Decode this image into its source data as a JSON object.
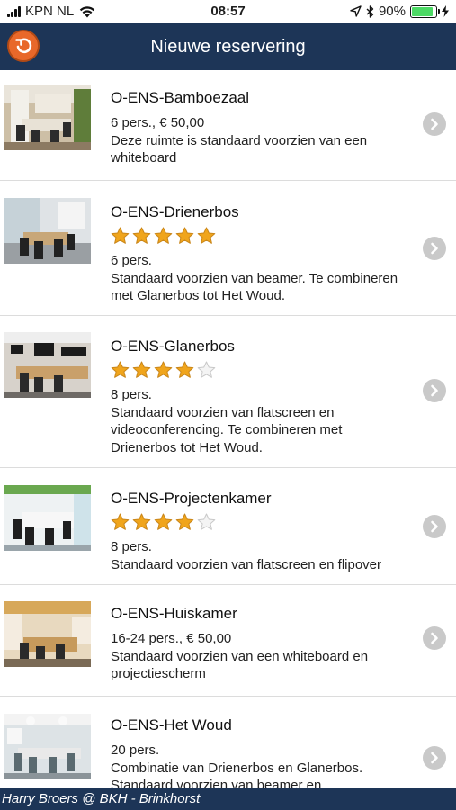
{
  "status_bar": {
    "carrier": "KPN NL",
    "time": "08:57",
    "battery_percent": "90%",
    "battery_level": 0.9
  },
  "nav": {
    "title": "Nieuwe reservering",
    "back_icon": "back-arrow-icon"
  },
  "rooms": [
    {
      "name": "O-ENS-Bamboezaal",
      "rating": null,
      "capacity_price": "6 pers., € 50,00",
      "description": "Deze ruimte is standaard voorzien van een whiteboard"
    },
    {
      "name": "O-ENS-Drienerbos",
      "rating": 5,
      "capacity_price": "6 pers.",
      "description": "Standaard voorzien van beamer. Te combineren met Glanerbos tot Het Woud."
    },
    {
      "name": "O-ENS-Glanerbos",
      "rating": 4,
      "capacity_price": "8 pers.",
      "description": "Standaard voorzien van flatscreen en videoconferencing. Te combineren met Drienerbos tot Het Woud."
    },
    {
      "name": "O-ENS-Projectenkamer",
      "rating": 4,
      "capacity_price": "8 pers.",
      "description": "Standaard voorzien van flatscreen en flipover"
    },
    {
      "name": "O-ENS-Huiskamer",
      "rating": null,
      "capacity_price": "16-24 pers., € 50,00",
      "description": "Standaard voorzien van een whiteboard en projectiescherm"
    },
    {
      "name": "O-ENS-Het Woud",
      "rating": null,
      "capacity_price": "20 pers.",
      "description": "Combinatie van Drienerbos en Glanerbos. Standaard voorzien van beamer en"
    }
  ],
  "footer": {
    "text": "Harry Broers @ BKH - Brinkhorst"
  },
  "colors": {
    "nav_bg": "#1d3557",
    "back_button": "#e8682a",
    "star_filled": "#f0a51c",
    "star_empty": "#dcdcdc",
    "chevron_bg": "#c9c9c9"
  }
}
